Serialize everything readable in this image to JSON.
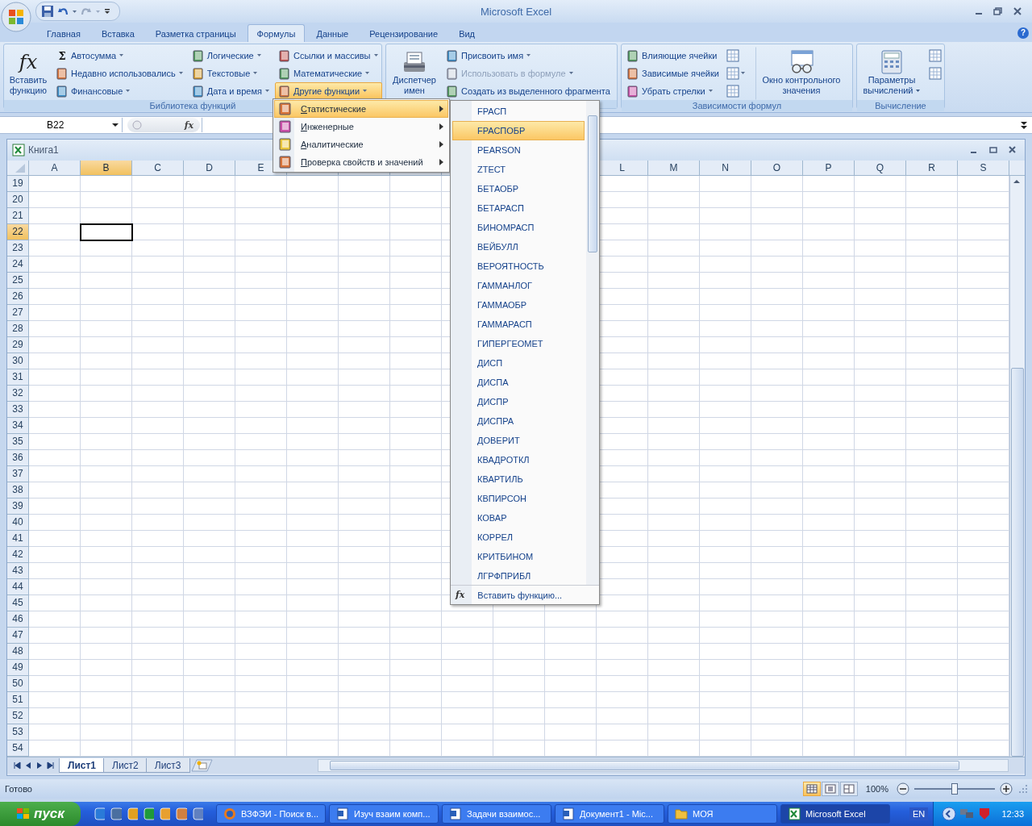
{
  "window": {
    "title": "Microsoft Excel",
    "help": "?"
  },
  "ribbon_tabs": [
    {
      "label": "Главная",
      "selected": false
    },
    {
      "label": "Вставка",
      "selected": false
    },
    {
      "label": "Разметка страницы",
      "selected": false
    },
    {
      "label": "Формулы",
      "selected": true
    },
    {
      "label": "Данные",
      "selected": false
    },
    {
      "label": "Рецензирование",
      "selected": false
    },
    {
      "label": "Вид",
      "selected": false
    }
  ],
  "ribbon_groups": [
    {
      "title": "Библиотека функций",
      "columns": [
        [
          {
            "kind": "large",
            "label": "Вставить функцию",
            "icon_text": "fx",
            "expanded": false,
            "disabled": false
          }
        ],
        [
          {
            "kind": "small",
            "label": "Автосумма",
            "icon_text": "Σ",
            "dropdown": true,
            "expanded": false,
            "disabled": false
          },
          {
            "kind": "small",
            "label": "Недавно использовались",
            "dropdown": true,
            "expanded": false,
            "disabled": false
          },
          {
            "kind": "small",
            "label": "Финансовые",
            "dropdown": true,
            "expanded": false,
            "disabled": false
          }
        ],
        [
          {
            "kind": "small",
            "label": "Логические",
            "dropdown": true,
            "expanded": false,
            "disabled": false
          },
          {
            "kind": "small",
            "label": "Текстовые",
            "dropdown": true,
            "expanded": false,
            "disabled": false
          },
          {
            "kind": "small",
            "label": "Дата и время",
            "dropdown": true,
            "expanded": false,
            "disabled": false
          }
        ],
        [
          {
            "kind": "small",
            "label": "Ссылки и массивы",
            "dropdown": true,
            "expanded": false,
            "disabled": false
          },
          {
            "kind": "small",
            "label": "Математические",
            "dropdown": true,
            "expanded": false,
            "disabled": false
          },
          {
            "kind": "small",
            "label": "Другие функции",
            "dropdown": true,
            "expanded": true,
            "disabled": false
          }
        ]
      ]
    },
    {
      "columns": [
        [
          {
            "kind": "large",
            "label": "Диспетчер имен",
            "expanded": false,
            "disabled": false
          }
        ],
        [
          {
            "kind": "small",
            "label": "Присвоить имя",
            "dropdown": true,
            "expanded": false,
            "disabled": false
          },
          {
            "kind": "small",
            "label": "Использовать в формуле",
            "dropdown": true,
            "expanded": false,
            "disabled": true
          },
          {
            "kind": "small",
            "label": "Создать из выделенного фрагмента",
            "dropdown": false,
            "expanded": false,
            "disabled": false
          }
        ]
      ]
    },
    {
      "title": "Зависимости формул",
      "columns": [
        [
          {
            "kind": "small",
            "label": "Влияющие ячейки",
            "dropdown": false,
            "expanded": false,
            "disabled": false
          },
          {
            "kind": "small",
            "label": "Зависимые ячейки",
            "dropdown": false,
            "expanded": false,
            "disabled": false
          },
          {
            "kind": "small",
            "label": "Убрать стрелки",
            "dropdown": true,
            "expanded": false,
            "disabled": false
          }
        ],
        [
          {
            "kind": "icon",
            "dropdown": false
          },
          {
            "kind": "icon",
            "dropdown": true
          },
          {
            "kind": "icon",
            "dropdown": false
          }
        ],
        [
          {
            "kind": "large",
            "label": "Окно контрольного значения",
            "expanded": false,
            "disabled": false
          }
        ]
      ]
    },
    {
      "title": "Вычисление",
      "columns": [
        [
          {
            "kind": "large",
            "label": "Параметры вычислений",
            "dropdown": true,
            "expanded": false,
            "disabled": false
          }
        ],
        [
          {
            "kind": "icon",
            "dropdown": false
          },
          {
            "kind": "icon",
            "dropdown": false
          }
        ]
      ]
    }
  ],
  "formula_bar": {
    "name_box": "B22",
    "fx": "fx"
  },
  "workbook": {
    "title": "Книга1"
  },
  "sheet": {
    "columns_left": [
      {
        "label": "A",
        "selected": false
      },
      {
        "label": "B",
        "selected": true
      },
      {
        "label": "C",
        "selected": false
      },
      {
        "label": "D",
        "selected": false
      },
      {
        "label": "E",
        "selected": false
      }
    ],
    "columns_right": [
      {
        "label": "L",
        "selected": false
      },
      {
        "label": "M",
        "selected": false
      },
      {
        "label": "N",
        "selected": false
      },
      {
        "label": "O",
        "selected": false
      },
      {
        "label": "P",
        "selected": false
      },
      {
        "label": "Q",
        "selected": false
      },
      {
        "label": "R",
        "selected": false
      },
      {
        "label": "S",
        "selected": false
      }
    ],
    "rows": [
      {
        "label": "19",
        "selected": false
      },
      {
        "label": "20",
        "selected": false
      },
      {
        "label": "21",
        "selected": false
      },
      {
        "label": "22",
        "selected": true
      },
      {
        "label": "23",
        "selected": false
      },
      {
        "label": "24",
        "selected": false
      },
      {
        "label": "25",
        "selected": false
      },
      {
        "label": "26",
        "selected": false
      },
      {
        "label": "27",
        "selected": false
      },
      {
        "label": "28",
        "selected": false
      },
      {
        "label": "29",
        "selected": false
      },
      {
        "label": "30",
        "selected": false
      },
      {
        "label": "31",
        "selected": false
      },
      {
        "label": "32",
        "selected": false
      },
      {
        "label": "33",
        "selected": false
      },
      {
        "label": "34",
        "selected": false
      },
      {
        "label": "35",
        "selected": false
      },
      {
        "label": "36",
        "selected": false
      },
      {
        "label": "37",
        "selected": false
      },
      {
        "label": "38",
        "selected": false
      },
      {
        "label": "39",
        "selected": false
      },
      {
        "label": "40",
        "selected": false
      },
      {
        "label": "41",
        "selected": false
      },
      {
        "label": "42",
        "selected": false
      },
      {
        "label": "43",
        "selected": false
      },
      {
        "label": "44",
        "selected": false
      },
      {
        "label": "45",
        "selected": false
      },
      {
        "label": "46",
        "selected": false
      },
      {
        "label": "47",
        "selected": false
      },
      {
        "label": "48",
        "selected": false
      },
      {
        "label": "49",
        "selected": false
      },
      {
        "label": "50",
        "selected": false
      },
      {
        "label": "51",
        "selected": false
      },
      {
        "label": "52",
        "selected": false
      },
      {
        "label": "53",
        "selected": false
      },
      {
        "label": "54",
        "selected": false
      }
    ]
  },
  "sheet_tabs": [
    {
      "label": "Лист1",
      "selected": true
    },
    {
      "label": "Лист2",
      "selected": false
    },
    {
      "label": "Лист3",
      "selected": false
    }
  ],
  "functions_menu": {
    "items": [
      {
        "label": "Статистические",
        "selected": true,
        "submenu": true
      },
      {
        "label": "Инженерные",
        "selected": false,
        "submenu": true
      },
      {
        "label": "Аналитические",
        "selected": false,
        "submenu": true
      },
      {
        "label": "Проверка свойств и значений",
        "selected": false,
        "submenu": true
      }
    ]
  },
  "statistical_submenu": {
    "items": [
      {
        "label": "FРАСП",
        "selected": false
      },
      {
        "label": "FРАСПОБР",
        "selected": true
      },
      {
        "label": "PEARSON",
        "selected": false
      },
      {
        "label": "ZТЕСТ",
        "selected": false
      },
      {
        "label": "БЕТАОБР",
        "selected": false
      },
      {
        "label": "БЕТАРАСП",
        "selected": false
      },
      {
        "label": "БИНОМРАСП",
        "selected": false
      },
      {
        "label": "ВЕЙБУЛЛ",
        "selected": false
      },
      {
        "label": "ВЕРОЯТНОСТЬ",
        "selected": false
      },
      {
        "label": "ГАММАНЛОГ",
        "selected": false
      },
      {
        "label": "ГАММАОБР",
        "selected": false
      },
      {
        "label": "ГАММАРАСП",
        "selected": false
      },
      {
        "label": "ГИПЕРГЕОМЕТ",
        "selected": false
      },
      {
        "label": "ДИСП",
        "selected": false
      },
      {
        "label": "ДИСПА",
        "selected": false
      },
      {
        "label": "ДИСПР",
        "selected": false
      },
      {
        "label": "ДИСПРА",
        "selected": false
      },
      {
        "label": "ДОВЕРИТ",
        "selected": false
      },
      {
        "label": "КВАДРОТКЛ",
        "selected": false
      },
      {
        "label": "КВАРТИЛЬ",
        "selected": false
      },
      {
        "label": "КВПИРСОН",
        "selected": false
      },
      {
        "label": "КОВАР",
        "selected": false
      },
      {
        "label": "КОРРЕЛ",
        "selected": false
      },
      {
        "label": "КРИТБИНОМ",
        "selected": false
      },
      {
        "label": "ЛГРФПРИБЛ",
        "selected": false
      }
    ],
    "footer": {
      "icon_text": "fx",
      "label": "Вставить функцию..."
    }
  },
  "status_bar": {
    "text": "Готово",
    "views": [
      {
        "selected": true
      },
      {
        "selected": false
      },
      {
        "selected": false
      }
    ],
    "zoom": {
      "reading": "100%",
      "level": 0.5
    }
  },
  "taskbar": {
    "start": "пуск",
    "tasks": [
      {
        "kind": "browser",
        "label": "ВЗФЭИ - Поиск в...",
        "selected": false
      },
      {
        "kind": "document",
        "label": "Изуч взаим комп...",
        "selected": false
      },
      {
        "kind": "document",
        "label": "Задачи взаимос...",
        "selected": false
      },
      {
        "kind": "document",
        "label": "Документ1 - Mic...",
        "selected": false
      },
      {
        "kind": "folder",
        "label": "МОЯ",
        "selected": false
      },
      {
        "kind": "spreadsheet",
        "label": "Microsoft Excel",
        "selected": true
      }
    ],
    "language": "EN",
    "clock": "12:33"
  }
}
